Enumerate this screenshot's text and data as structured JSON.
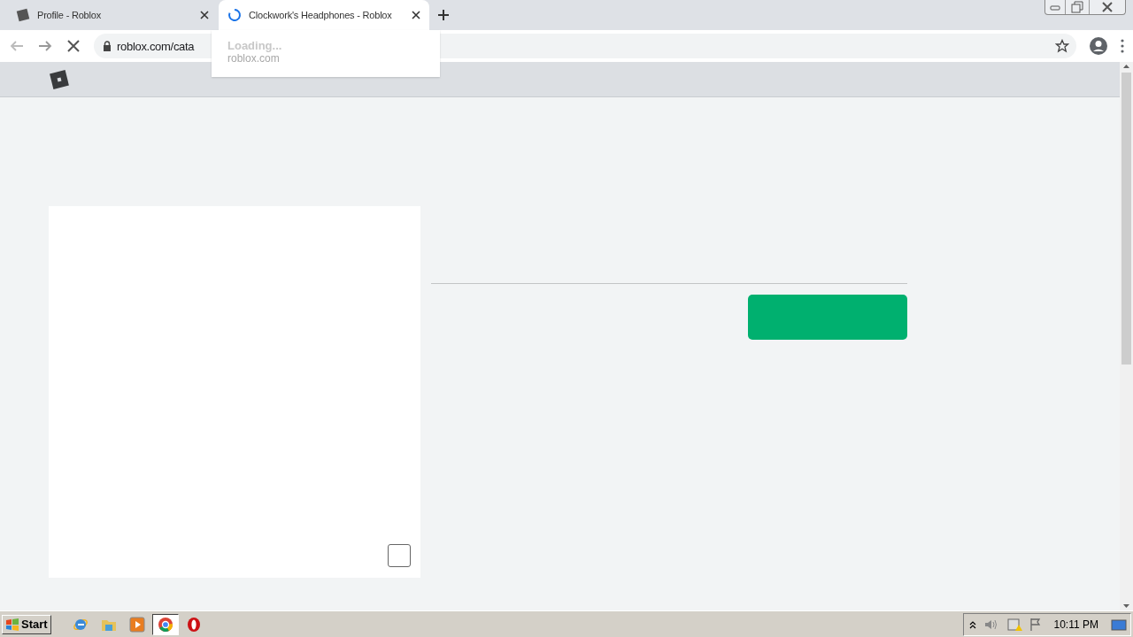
{
  "browser": {
    "tabs": [
      {
        "title": "Profile - Roblox",
        "selected": false,
        "loading": false
      },
      {
        "title": "Clockwork's Headphones - Roblox",
        "selected": true,
        "loading": true
      }
    ],
    "loading": true,
    "address": "roblox.com/cata",
    "popup": {
      "status": "Loading...",
      "host": "roblox.com"
    },
    "image_checkbox": {
      "checked": false
    }
  },
  "taskbar": {
    "start": "Start",
    "apps": [
      {
        "kind": "ie",
        "selected": false
      },
      {
        "kind": "folder",
        "selected": false
      },
      {
        "kind": "media",
        "selected": false
      },
      {
        "kind": "chrome",
        "selected": true
      },
      {
        "kind": "opera",
        "selected": false
      }
    ],
    "clock": "10:11 PM"
  }
}
